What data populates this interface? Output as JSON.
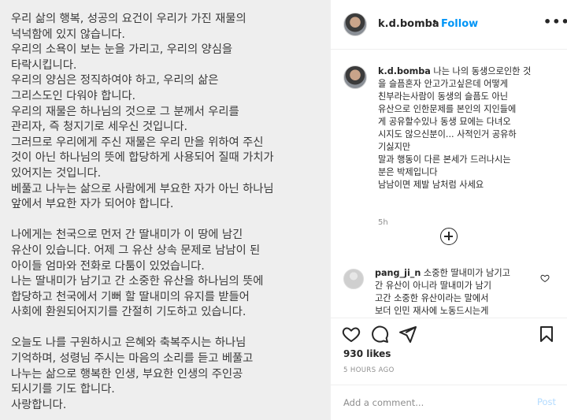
{
  "post_image": {
    "paragraphs": [
      [
        "우리 삶의 행복, 성공의 요건이 우리가 가진 재물의",
        "넉넉함에 있지 않습니다.",
        "우리의 소욕이 보는 눈을 가리고, 우리의 양심을",
        "타락시킵니다.",
        "우리의 양심은 정직하여야 하고,  우리의 삶은",
        "그리스도인 다워야 합니다.",
        "우리의 재물은 하나님의 것으로 그 분께서 우리를",
        "관리자, 즉 청지기로 세우신 것입니다.",
        "그러므로 우리에게 주신 재물은 우리 만을 위하여 주신",
        "것이 아닌 하나님의 뜻에 합당하게 사용되어 질때 가치가",
        "있어지는 것입니다.",
        "베풀고 나누는 삶으로 사람에게 부요한 자가 아닌 하나님",
        "앞에서 부요한 자가  되어야 합니다."
      ],
      [
        "나에게는 천국으로 먼저 간 딸내미가 이 땅에 남긴",
        "유산이 있습니다. 어제 그 유산 상속 문제로 남남이 된",
        "아이들 엄마와 전화로 다툼이 있었습니다.",
        "나는 딸내미가 남기고 간 소중한 유산을 하나님의 뜻에",
        "합당하고 천국에서 기뻐 할 딸내미의 유지를 받들어",
        "사회에 환원되어지기를 간절히 기도하고 있습니다."
      ],
      [
        "오늘도 나를 구원하시고 은혜와 축복주시는 하나님",
        "기억하며, 성령님 주시는 마음의 소리를 듣고 베풀고",
        "나누는 삶으로 행복한 인생, 부요한 인생의 주인공",
        "되시기를 기도 합니다.",
        "사랑합니다."
      ]
    ]
  },
  "header": {
    "username": "k.d.bomba",
    "separator": "•",
    "follow_label": "Follow",
    "more_label": "•••"
  },
  "caption": {
    "username": "k.d.bomba",
    "first_line": " 나는 나의 동생으로인한 것",
    "lines": [
      "을 슬픔혼자 안고가고싶은데 어떻게",
      "친부라는사람이 동생의 슬픔도 아닌",
      "유산으로 인한문제를 본인의 지인들에",
      "게 공유할수있나 동생 묘에는 다녀오",
      "시지도 않으신분이... 사적인거 공유하",
      "기싫지만",
      "말과 행동이 다른 본세가 드러나시는",
      "분은 박제입니다",
      "남남이면 제발 남처럼 사세요"
    ],
    "time": "5h"
  },
  "comment": {
    "username": "pang_ji_n",
    "first_line": " 소중한 딸내미가 남기고",
    "lines": [
      "간 유산이 아니라 딸내미가 남기",
      "고간 소중한 유산이라는 말에서",
      "보더 인민 재사에 노동드시는게"
    ]
  },
  "actions": {
    "likes": "930 likes",
    "time_ago": "5 HOURS AGO"
  },
  "add_comment": {
    "placeholder": "Add a comment...",
    "post_label": "Post"
  },
  "icons": [
    "heart-icon",
    "comment-icon",
    "share-icon",
    "bookmark-icon",
    "plus-circle-icon",
    "small-heart-icon",
    "more-icon"
  ],
  "colors": {
    "accent": "#0095f6",
    "post_disabled": "#b3dbff",
    "muted": "#8e8e8e",
    "image_background": "#eeeeee"
  }
}
